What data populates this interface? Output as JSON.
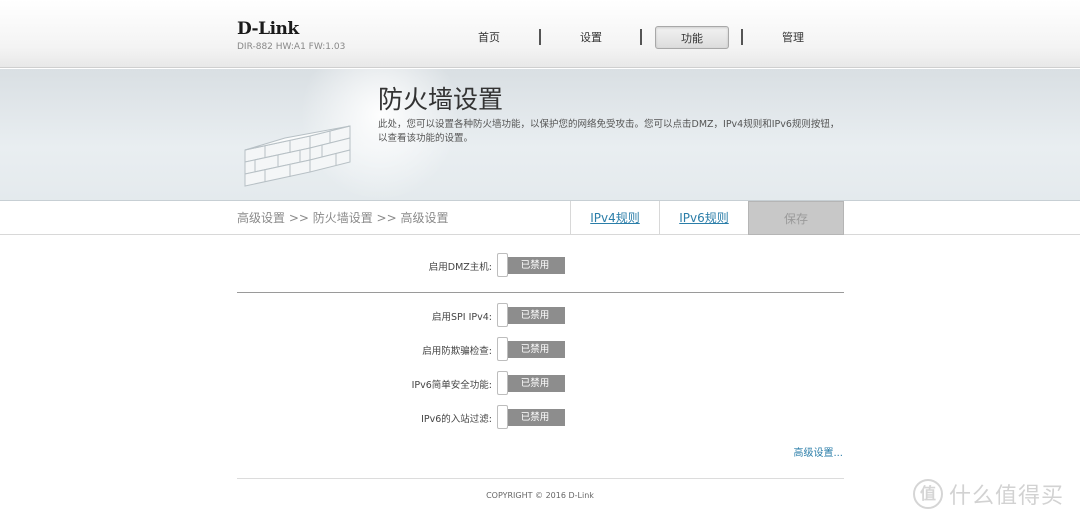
{
  "brand": {
    "logo": "D-Link",
    "model": "DIR-882 HW:A1 FW:1.03"
  },
  "nav": {
    "home": "首页",
    "settings": "设置",
    "features": "功能",
    "management": "管理"
  },
  "banner": {
    "title": "防火墙设置",
    "description": "此处，您可以设置各种防火墙功能，以保护您的网络免受攻击。您可以点击DMZ，IPv4规则和IPv6规则按钮，以查看该功能的设置。"
  },
  "breadcrumb": "高级设置 >> 防火墙设置 >> 高级设置",
  "tabs": {
    "ipv4": "IPv4规则",
    "ipv6": "IPv6规则",
    "save": "保存"
  },
  "settings": [
    {
      "label": "启用DMZ主机:",
      "state": "已禁用"
    },
    {
      "label": "启用SPI IPv4:",
      "state": "已禁用"
    },
    {
      "label": "启用防欺骗检查:",
      "state": "已禁用"
    },
    {
      "label": "IPv6简单安全功能:",
      "state": "已禁用"
    },
    {
      "label": "IPv6的入站过滤:",
      "state": "已禁用"
    }
  ],
  "advanced_link": "高级设置...",
  "copyright": "COPYRIGHT © 2016 D-Link",
  "watermark": {
    "icon": "值",
    "text": "什么值得买"
  }
}
